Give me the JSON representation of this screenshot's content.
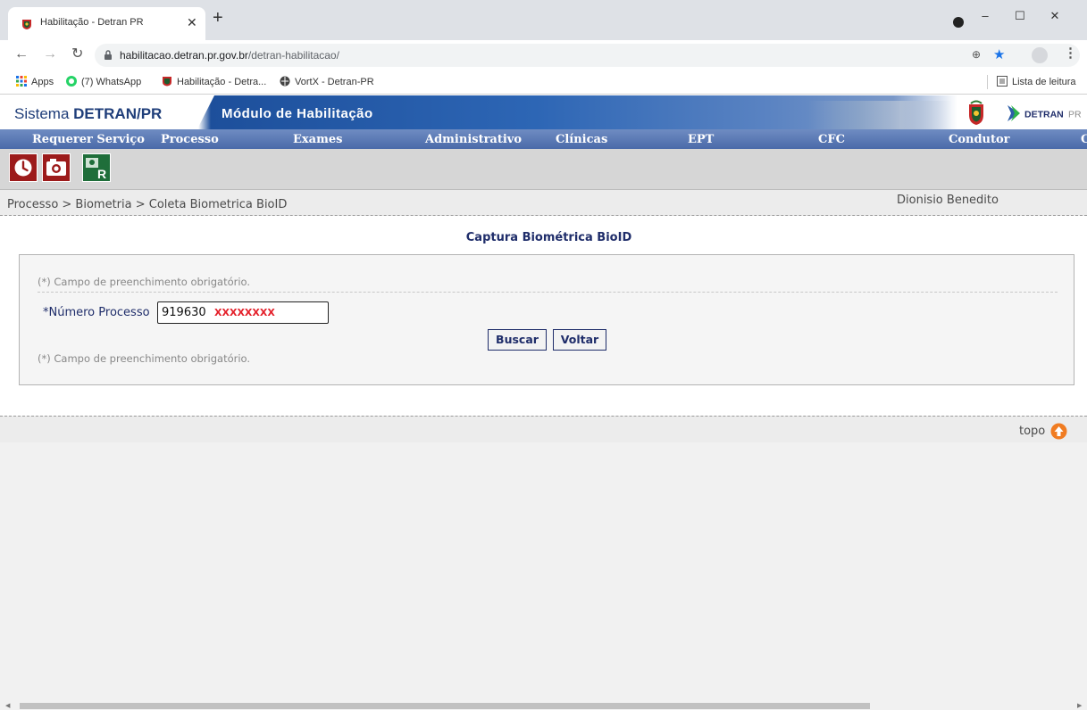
{
  "browser": {
    "tab_title": "Habilitação - Detran PR",
    "url_host": "habilitacao.detran.pr.gov.br",
    "url_path": "/detran-habilitacao/",
    "bookmarks": [
      {
        "label": "Apps",
        "icon": "apps-grid-icon"
      },
      {
        "label": "(7) WhatsApp",
        "icon": "whatsapp-icon"
      },
      {
        "label": "Habilitação - Detra...",
        "icon": "pr-crest-icon"
      },
      {
        "label": "VortX - Detran-PR",
        "icon": "globe-icon"
      }
    ],
    "reading_list": "Lista de leitura"
  },
  "header": {
    "system_prefix": "Sistema",
    "system_name": "DETRAN/PR",
    "module": "Módulo de Habilitação",
    "logo_text": "DETRAN",
    "logo_suffix": "PR"
  },
  "menu": [
    "Requerer Serviço",
    "Processo",
    "Exames",
    "Administrativo",
    "Clínicas",
    "EPT",
    "CFC",
    "Condutor",
    "C"
  ],
  "icon_toolbar": [
    "clock-icon",
    "camera-icon",
    "biometric-r-icon"
  ],
  "breadcrumb": "Processo > Biometria > Coleta Biometrica BioID",
  "user_name": "Dionisio Benedito",
  "page_title": "Captura Biométrica BioID",
  "form": {
    "required_note": "(*) Campo de preenchimento obrigatório.",
    "field_label": "*Número Processo",
    "field_value": "919630",
    "field_mask": "XXXXXXXX",
    "search_button": "Buscar",
    "back_button": "Voltar"
  },
  "footer": {
    "top_link": "topo"
  },
  "colors": {
    "navy": "#1f2d6a",
    "menu_blue": "#5b78b3",
    "required_red": "#e4202a",
    "topo_orange": "#f07c22"
  }
}
